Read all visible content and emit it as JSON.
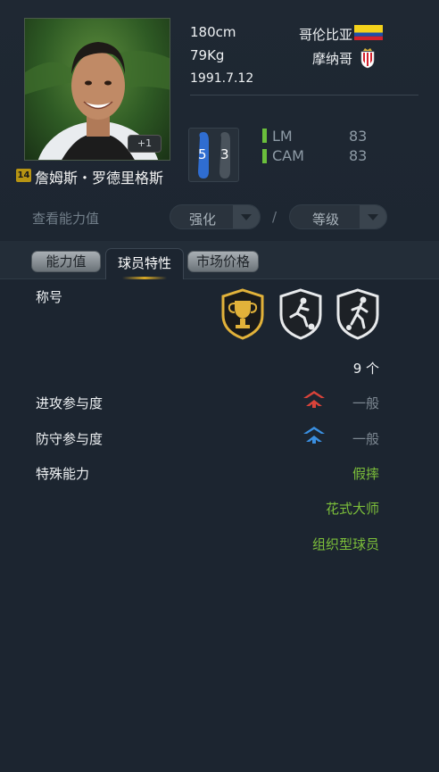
{
  "player": {
    "name": "詹姆斯・罗德里格斯",
    "season_badge": "14",
    "upgrade_badge": "+1",
    "height": "180cm",
    "weight": "79Kg",
    "birthdate": "1991.7.12",
    "nationality": "哥伦比亚",
    "club": "摩纳哥",
    "weak_foot": {
      "left": "5",
      "right": "3"
    },
    "positions": [
      {
        "pos": "LM",
        "rating": "83"
      },
      {
        "pos": "CAM",
        "rating": "83"
      }
    ]
  },
  "controls": {
    "view_label": "查看能力值",
    "upgrade_dropdown": "强化",
    "separator": "/",
    "level_dropdown": "等级"
  },
  "tabs": [
    {
      "label": "能力值",
      "active": false
    },
    {
      "label": "球员特性",
      "active": true
    },
    {
      "label": "市场价格",
      "active": false
    }
  ],
  "traits": {
    "title_label": "称号",
    "title_badges": [
      "trophy-badge-icon",
      "dribbling-player-badge-icon",
      "running-player-badge-icon"
    ],
    "count": "9 个",
    "attack_label": "进攻参与度",
    "attack_value": "一般",
    "defense_label": "防守参与度",
    "defense_value": "一般",
    "special_label": "特殊能力",
    "specials": [
      "假摔",
      "花式大师",
      "组织型球员"
    ]
  },
  "colors": {
    "background": "#1c2530",
    "accent_green": "#7cbf3a",
    "gold": "#d7a826",
    "attack_red": "#d9433a",
    "defense_blue": "#3a8fe0"
  }
}
